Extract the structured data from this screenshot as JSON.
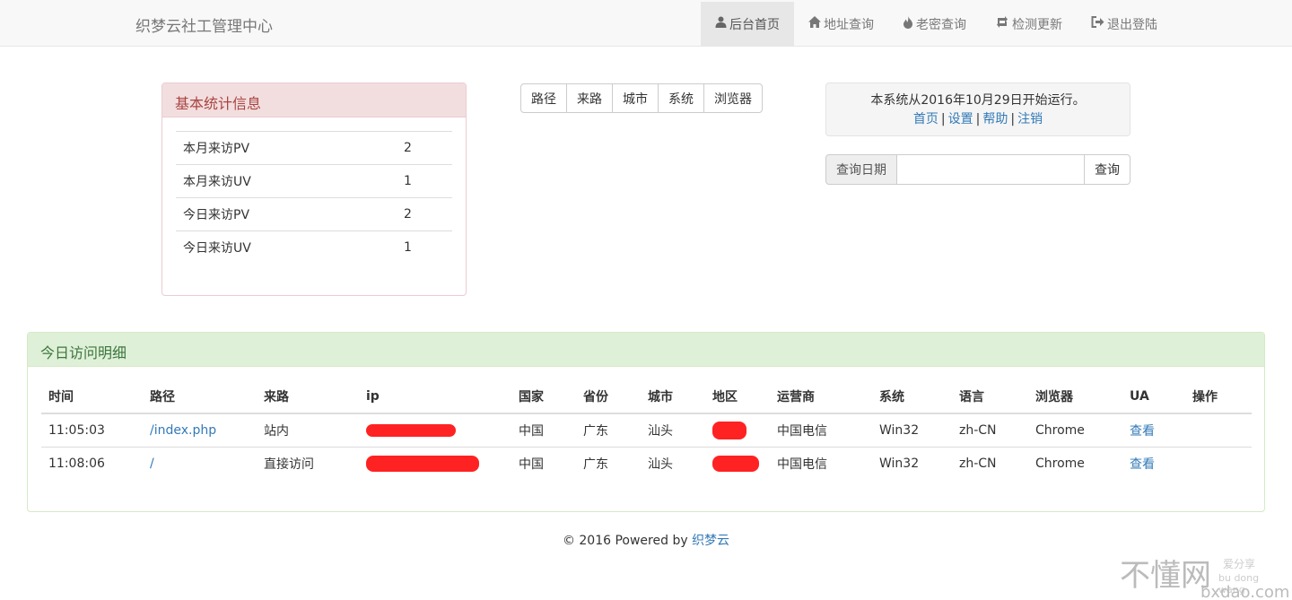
{
  "navbar": {
    "brand": "织梦云社工管理中心",
    "items": [
      {
        "label": "后台首页",
        "icon": "user-icon",
        "active": true
      },
      {
        "label": "地址查询",
        "icon": "home-icon"
      },
      {
        "label": "老密查询",
        "icon": "fire-icon"
      },
      {
        "label": "检测更新",
        "icon": "retweet-icon"
      },
      {
        "label": "退出登陆",
        "icon": "logout-icon"
      }
    ]
  },
  "stats": {
    "title": "基本统计信息",
    "rows": [
      {
        "label": "本月来访PV",
        "value": "2"
      },
      {
        "label": "本月来访UV",
        "value": "1"
      },
      {
        "label": "今日来访PV",
        "value": "2"
      },
      {
        "label": "今日来访UV",
        "value": "1"
      }
    ]
  },
  "filters": [
    "路径",
    "来路",
    "城市",
    "系统",
    "浏览器"
  ],
  "info": {
    "running_text": "本系统从2016年10月29日开始运行。",
    "links": [
      "首页",
      "设置",
      "帮助",
      "注销"
    ],
    "separator": "|"
  },
  "query": {
    "addon": "查询日期",
    "input_value": "",
    "button": "查询"
  },
  "details": {
    "title": "今日访问明细",
    "columns": [
      "时间",
      "路径",
      "来路",
      "ip",
      "国家",
      "省份",
      "城市",
      "地区",
      "运营商",
      "系统",
      "语言",
      "浏览器",
      "UA",
      "操作"
    ],
    "rows": [
      {
        "time": "11:05:03",
        "path": "/index.php",
        "referer": "站内",
        "country": "中国",
        "province": "广东",
        "city": "汕头",
        "isp": "中国电信",
        "os": "Win32",
        "lang": "zh-CN",
        "browser": "Chrome",
        "ua": "查看"
      },
      {
        "time": "11:08:06",
        "path": "/",
        "referer": "直接访问",
        "country": "中国",
        "province": "广东",
        "city": "汕头",
        "isp": "中国电信",
        "os": "Win32",
        "lang": "zh-CN",
        "browser": "Chrome",
        "ua": "查看"
      }
    ]
  },
  "footer": {
    "text": "© 2016 Powered by ",
    "link": "织梦云"
  },
  "watermark": {
    "main": "不懂网",
    "sub": "爱分享",
    "pinyin": "bu dong wang",
    "url": "bxdao.com"
  },
  "colors": {
    "danger_heading": "#f2dede",
    "success_heading": "#dff0d8",
    "link": "#337ab7",
    "redaction": "#ff2222"
  }
}
